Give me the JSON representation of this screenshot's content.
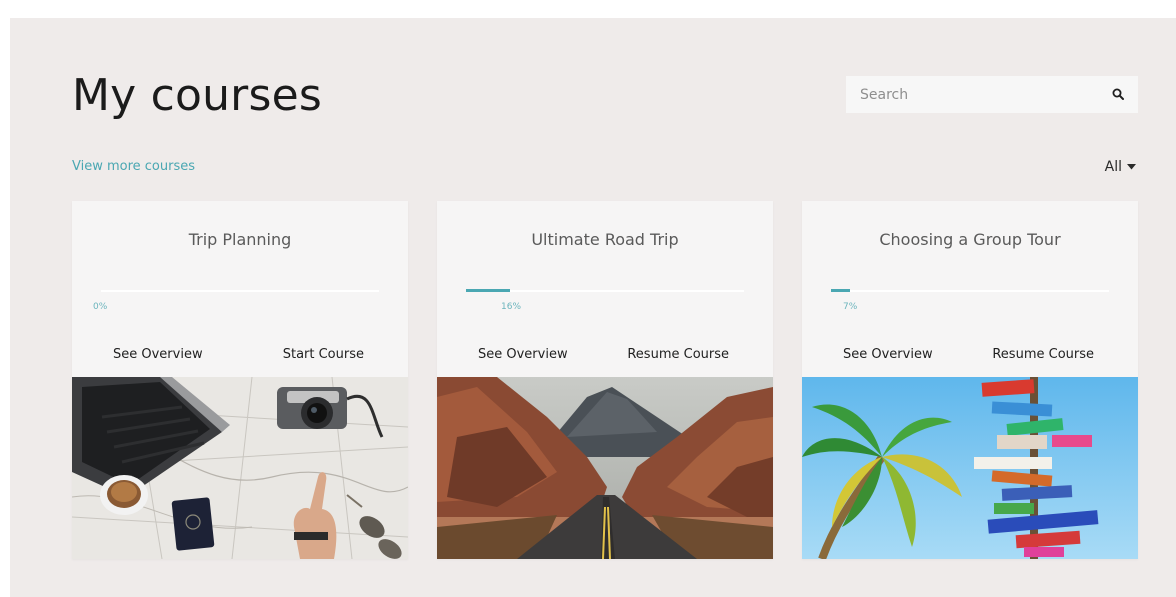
{
  "header": {
    "title": "My courses",
    "view_more_label": "View more courses",
    "filter_label": "All"
  },
  "search": {
    "placeholder": "Search"
  },
  "colors": {
    "accent": "#4aa7b2",
    "page_bg": "#efebea",
    "card_bg": "#f6f5f5"
  },
  "courses": [
    {
      "title": "Trip Planning",
      "progress": 0,
      "progress_label": "0%",
      "overview_label": "See Overview",
      "action_label": "Start Course",
      "image": "map-laptop-camera-passport-photo"
    },
    {
      "title": "Ultimate Road Trip",
      "progress": 16,
      "progress_label": "16%",
      "overview_label": "See Overview",
      "action_label": "Resume Course",
      "image": "desert-road-canyon-photo"
    },
    {
      "title": "Choosing a Group Tour",
      "progress": 7,
      "progress_label": "7%",
      "overview_label": "See Overview",
      "action_label": "Resume Course",
      "image": "palm-tree-signpost-photo"
    }
  ]
}
